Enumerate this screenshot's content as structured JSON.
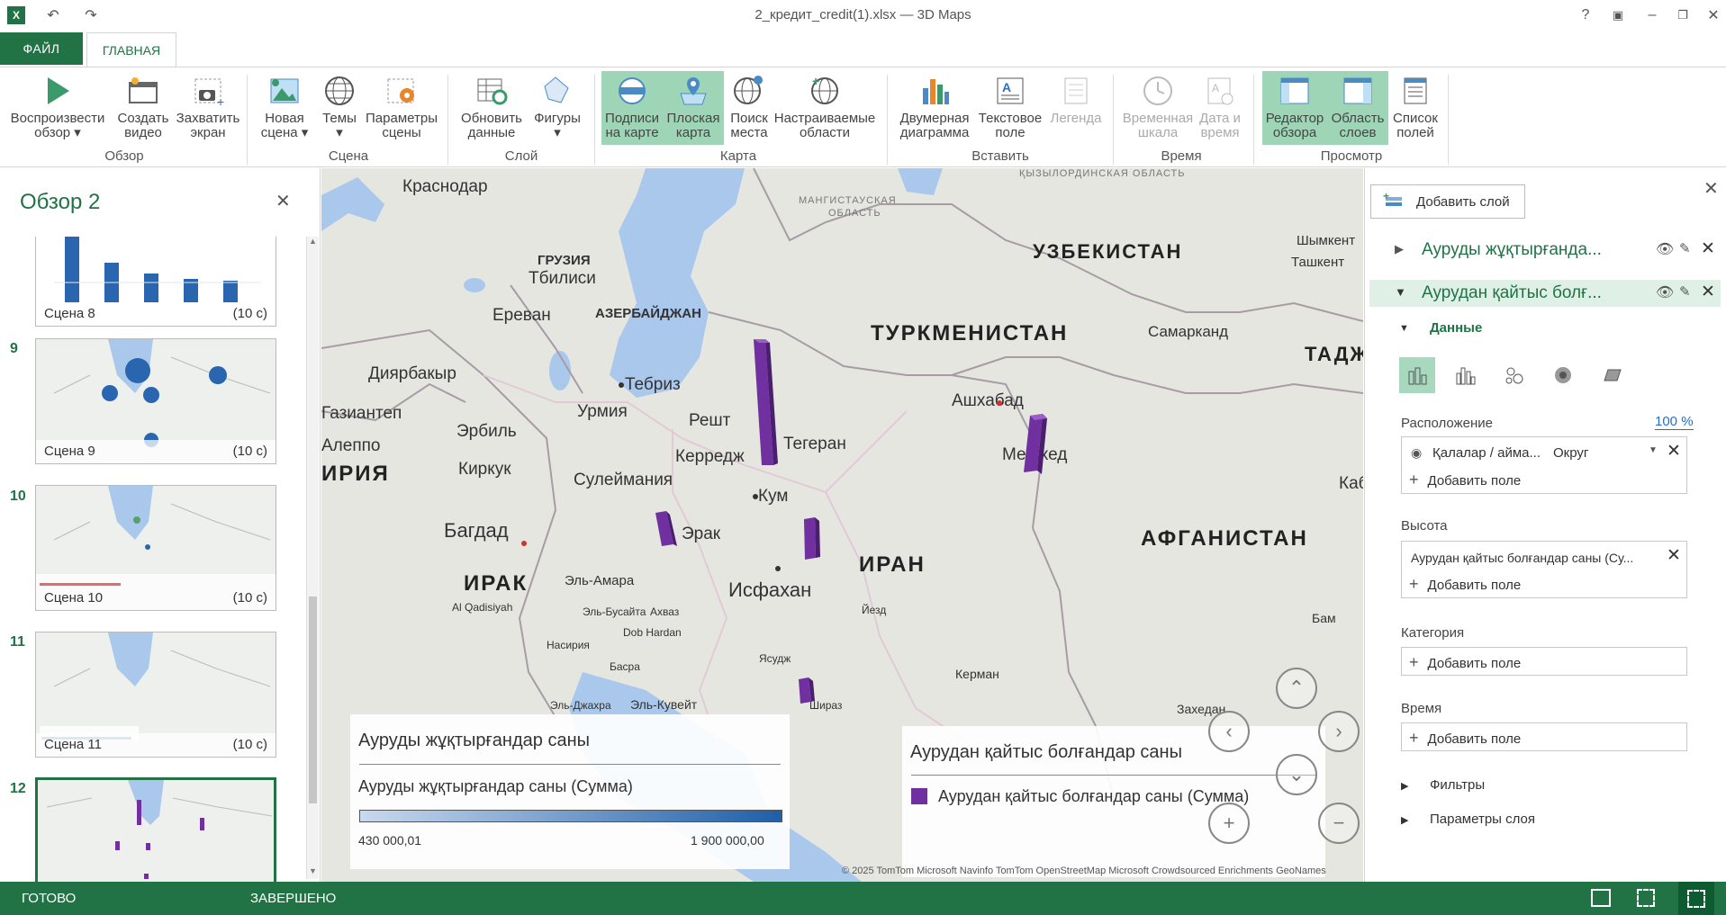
{
  "window": {
    "title": "2_кредит_credit(1).xlsx — 3D Maps",
    "help": "?"
  },
  "tabs": {
    "file": "ФАЙЛ",
    "home": "ГЛАВНАЯ"
  },
  "ribbon": {
    "tour": {
      "play_l1": "Воспроизвести",
      "play_l2": "обзор",
      "create_l1": "Создать",
      "create_l2": "видео",
      "capture_l1": "Захватить",
      "capture_l2": "экран",
      "group": "Обзор"
    },
    "scene": {
      "new_l1": "Новая",
      "new_l2": "сцена",
      "themes": "Темы",
      "params_l1": "Параметры",
      "params_l2": "сцены",
      "group": "Сцена"
    },
    "layer": {
      "refresh_l1": "Обновить",
      "refresh_l2": "данные",
      "shapes": "Фигуры",
      "group": "Слой"
    },
    "map": {
      "labels_l1": "Подписи",
      "labels_l2": "на карте",
      "flat_l1": "Плоская",
      "flat_l2": "карта",
      "find_l1": "Поиск",
      "find_l2": "места",
      "custom_l1": "Настраиваемые",
      "custom_l2": "области",
      "group": "Карта"
    },
    "insert": {
      "chart_l1": "Двумерная",
      "chart_l2": "диаграмма",
      "text_l1": "Текстовое",
      "text_l2": "поле",
      "legend": "Легенда",
      "group": "Вставить"
    },
    "time": {
      "timeline_l1": "Временная",
      "timeline_l2": "шкала",
      "datetime_l1": "Дата и",
      "datetime_l2": "время",
      "group": "Время"
    },
    "view": {
      "editor_l1": "Редактор",
      "editor_l2": "обзора",
      "layers_l1": "Область",
      "layers_l2": "слоев",
      "fields_l1": "Список",
      "fields_l2": "полей",
      "group": "Просмотр"
    }
  },
  "tour_pane": {
    "title": "Обзор 2",
    "scenes": [
      {
        "num": "",
        "name": "Сцена 8",
        "dur": "(10 с)"
      },
      {
        "num": "9",
        "name": "Сцена 9",
        "dur": "(10 с)"
      },
      {
        "num": "10",
        "name": "Сцена 10",
        "dur": "(10 с)"
      },
      {
        "num": "11",
        "name": "Сцена 11",
        "dur": "(10 с)"
      },
      {
        "num": "12",
        "name": "",
        "dur": ""
      }
    ]
  },
  "map": {
    "labels": [
      "Краснодар",
      "МАНГИСТАУСКАЯ",
      "ОБЛАСТЬ",
      "ҚЫЗЫЛОРДИНСКАЯ ОБЛАСТЬ",
      "ГРУЗИЯ",
      "Тбилиси",
      "Ереван",
      "АЗЕРБАЙДЖАН",
      "Диярбакыр",
      "Тебриз",
      "Урмия",
      "Решт",
      "Газиантеп",
      "Эрбиль",
      "Керредж",
      "Тегеран",
      "Алеппо",
      "Киркук",
      "Сулеймания",
      "Кум",
      "Багдад",
      "Эрак",
      "ИРАК",
      "Эль-Амара",
      "Исфахан",
      "Al Qadisiyah",
      "Эль-Бусайта",
      "Ахваз",
      "Dob Hardan",
      "Насирия",
      "Басра",
      "Ясудж",
      "Эль-Джахра",
      "Эль-Кувейт",
      "Шираз",
      "Шымкент",
      "Ташкент",
      "Самарканд",
      "Ашхабад",
      "Мешхед",
      "Йезд",
      "Керман",
      "Захедан",
      "Кабул",
      "Бам"
    ],
    "big_labels": [
      "УЗБЕКИСТАН",
      "ТУРКМЕНИСТАН",
      "ИРАН",
      "АФГАНИСТАН",
      "ИРИЯ",
      "ИРАК",
      "ТАДЖ"
    ],
    "copyright": "© 2025 TomTom  Microsoft  Navinfo  TomTom  OpenStreetMap  Microsoft Crowdsourced Enrichments  GeoNames"
  },
  "legend1": {
    "title": "Ауруды жұқтырғандар саны",
    "subtitle": "Ауруды жұқтырғандар саны (Сумма)",
    "min": "430 000,01",
    "max": "1 900 000,00",
    "color_low": "#c9d9ee",
    "color_high": "#1f5fa8"
  },
  "legend2": {
    "title": "Аурудан қайтыс болғандар саны",
    "item": "Аурудан қайтыс болғандар саны (Сумма)",
    "color": "#7030a0"
  },
  "layers_pane": {
    "add_layer": "Добавить слой",
    "layer1": "Ауруды жұқтырғанда...",
    "layer2": "Аурудан қайтыс болғ...",
    "data": "Данные",
    "location_label": "Расположение",
    "location_pct": "100 %",
    "location_field": "Қалалар / айма...",
    "location_type": "Округ",
    "add_field": "Добавить поле",
    "height_label": "Высота",
    "height_field": "Аурудан қайтыс болғандар саны (Су...",
    "category_label": "Категория",
    "time_label": "Время",
    "filters": "Фильтры",
    "layer_params": "Параметры слоя"
  },
  "status": {
    "ready": "ГОТОВО",
    "done": "ЗАВЕРШЕНО"
  },
  "chart_data": {
    "type": "bar",
    "note_free": true,
    "categories": [
      "Тегеран",
      "Мешхед",
      "Эрак",
      "Исфахан",
      "Шираз"
    ],
    "values": [],
    "title": "",
    "xlabel": "",
    "ylabel": ""
  }
}
